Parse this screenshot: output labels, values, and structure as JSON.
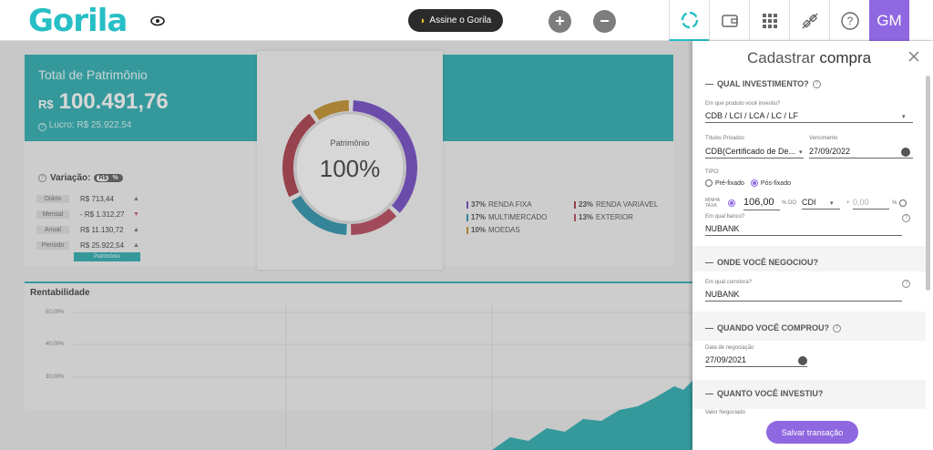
{
  "header": {
    "logo": "Gorila",
    "subscribe_label": "Assine o Gorila",
    "plus_symbol": "+",
    "minus_symbol": "−",
    "avatar_initials": "GM",
    "accent": "#26bfc5",
    "purple": "#8f67e0"
  },
  "summary": {
    "title": "Total de Patrimônio",
    "currency": "R$",
    "value": "100.491,76",
    "lucro": "Lucro: R$ 25.922,54",
    "variation_label": "Variação:",
    "toggle_a": "R$",
    "toggle_b": "%",
    "rows": [
      {
        "key": "Diário",
        "value": "R$ 713,44",
        "dir": "up"
      },
      {
        "key": "Mensal",
        "value": "- R$ 1.312,27",
        "dir": "down"
      },
      {
        "key": "Anual",
        "value": "R$ 11.130,72",
        "dir": "up"
      },
      {
        "key": "Período",
        "value": "R$ 25.922,54",
        "dir": "up"
      }
    ],
    "tag": "Patrimônio"
  },
  "donut": {
    "label": "Patrimônio",
    "percent": "100%"
  },
  "chart_data": {
    "type": "pie",
    "title": "Patrimônio",
    "categories": [
      "RENDA FIXA",
      "RENDA VARIÁVEL",
      "MULTIMERCADO",
      "EXTERIOR",
      "MOEDAS"
    ],
    "values": [
      37,
      23,
      17,
      13,
      10
    ],
    "colors": [
      "#6a3fc3",
      "#a7313f",
      "#1f8ea8",
      "#b43e52",
      "#c08a1f"
    ]
  },
  "legend": [
    {
      "pct": "37%",
      "label": "RENDA FIXA",
      "color": "#6a3fc3"
    },
    {
      "pct": "23%",
      "label": "RENDA VARIÁVEL",
      "color": "#a7313f"
    },
    {
      "pct": "17%",
      "label": "MULTIMERCADO",
      "color": "#1f8ea8"
    },
    {
      "pct": "13%",
      "label": "EXTERIOR",
      "color": "#b43e52"
    },
    {
      "pct": "10%",
      "label": "MOEDAS",
      "color": "#c08a1f"
    }
  ],
  "rentabilidade": {
    "title": "Rentabilidade",
    "yticks": [
      "50,00%",
      "40,00%",
      "30,00%"
    ]
  },
  "form": {
    "title_a": "Cadastrar",
    "title_b": "compra",
    "s1_title": "QUAL INVESTIMENTO?",
    "produto_label": "Em que produto você investiu?",
    "produto_value": "CDB / LCI / LCA / LC / LF",
    "titulos_label": "Títulos Privados",
    "titulos_value": "CDB(Certificado de De...",
    "vencimento_label": "Vencimento",
    "vencimento_value": "27/09/2022",
    "tipo_label": "TIPO:",
    "tipo_pre": "Pré-fixado",
    "tipo_pos": "Pós-fixado",
    "taxa_label": "MINHA TAXA",
    "taxa_value": "106,00",
    "taxa_unit": "% DO",
    "indexador": "CDI",
    "plus_value": "0,00",
    "plus_sign": "+",
    "pct_sign": "%",
    "banco_label": "Em qual banco?",
    "banco_value": "NUBANK",
    "s2_title": "ONDE VOCÊ NEGOCIOU?",
    "corretora_label": "Em qual corretora?",
    "corretora_value": "NUBANK",
    "s3_title": "QUANDO VOCÊ COMPROU?",
    "data_label": "Data de negociação",
    "data_value": "27/09/2021",
    "s4_title": "QUANTO VOCÊ INVESTIU?",
    "valor_label": "Valor Negociado",
    "save_label": "Salvar transação",
    "dash": "—",
    "caret": "▾",
    "close_symbol": "×",
    "question": "?"
  }
}
